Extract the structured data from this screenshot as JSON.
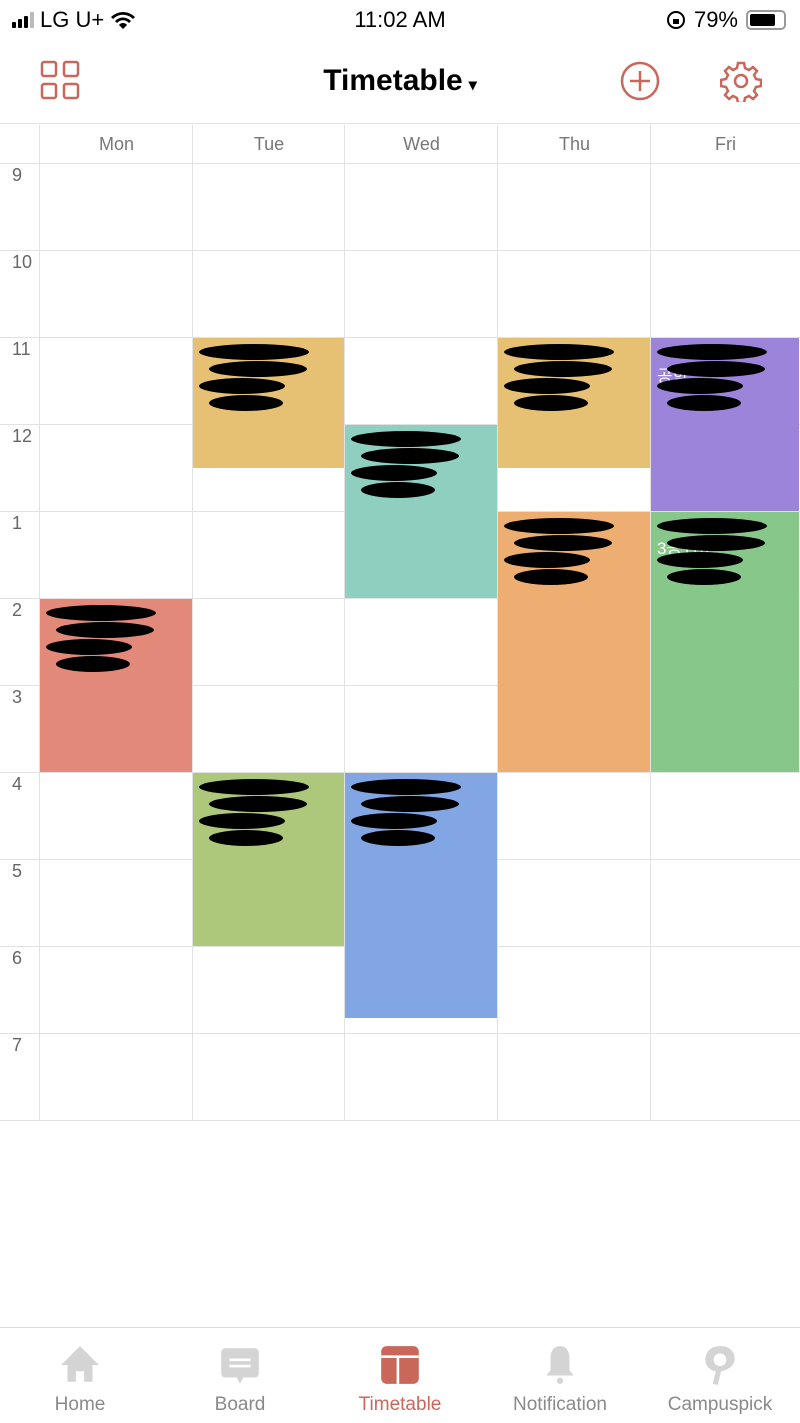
{
  "status_bar": {
    "carrier": "LG U+",
    "time": "11:02 AM",
    "battery": "79%",
    "battery_level": 0.79
  },
  "header": {
    "title": "Timetable",
    "caret": "▾",
    "left_icon": "grid-icon",
    "add_icon": "plus-circle-icon",
    "settings_icon": "gear-icon"
  },
  "colors": {
    "accent": "#c9675a"
  },
  "timetable": {
    "days": [
      "Mon",
      "Tue",
      "Wed",
      "Thu",
      "Fri"
    ],
    "hours": [
      "9",
      "10",
      "11",
      "12",
      "1",
      "2",
      "3",
      "4",
      "5",
      "6",
      "7"
    ],
    "courses": [
      {
        "day": 1,
        "start": 11,
        "end": 12.5,
        "color": "#e6c174",
        "text": ""
      },
      {
        "day": 2,
        "start": 12,
        "end": 14,
        "color": "#8fcfc0",
        "text": ""
      },
      {
        "day": 3,
        "start": 11,
        "end": 12.5,
        "color": "#e6c174",
        "text": ""
      },
      {
        "day": 4,
        "start": 11,
        "end": 13,
        "color": "#9b84d9",
        "text": "공학"
      },
      {
        "day": 0,
        "start": 14,
        "end": 16,
        "color": "#e2897a",
        "text": ""
      },
      {
        "day": 3,
        "start": 13,
        "end": 16,
        "color": "#eeae72",
        "text": ""
      },
      {
        "day": 4,
        "start": 13,
        "end": 16,
        "color": "#88c78a",
        "text": "3공110"
      },
      {
        "day": 1,
        "start": 16,
        "end": 18,
        "color": "#adc87b",
        "text": ""
      },
      {
        "day": 2,
        "start": 16,
        "end": 18.83,
        "color": "#82a5e3",
        "text": ""
      }
    ]
  },
  "tabbar": {
    "items": [
      {
        "label": "Home",
        "icon": "home-icon",
        "active": false
      },
      {
        "label": "Board",
        "icon": "board-icon",
        "active": false
      },
      {
        "label": "Timetable",
        "icon": "timetable-icon",
        "active": true
      },
      {
        "label": "Notification",
        "icon": "bell-icon",
        "active": false
      },
      {
        "label": "Campuspick",
        "icon": "campuspick-icon",
        "active": false
      }
    ]
  }
}
